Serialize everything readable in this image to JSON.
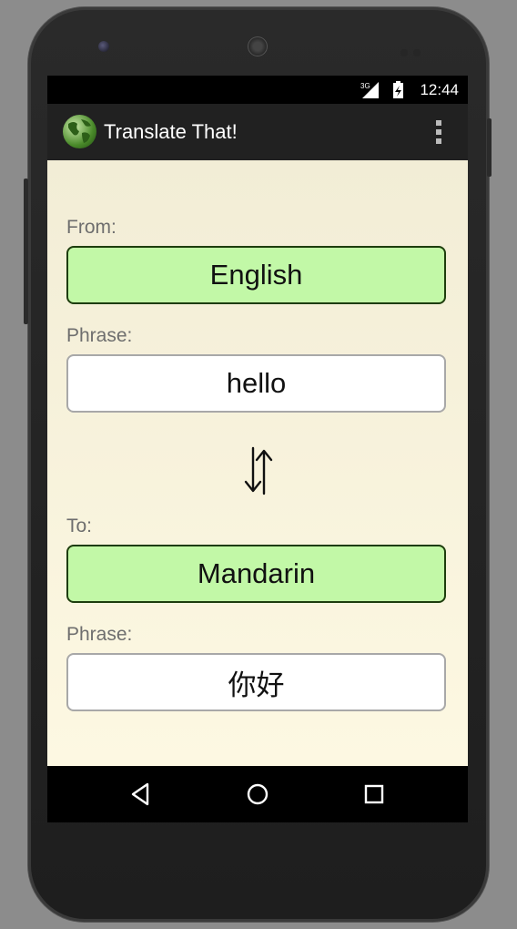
{
  "status_bar": {
    "network": "3G",
    "time": "12:44"
  },
  "action_bar": {
    "title": "Translate That!",
    "logo_icon": "globe-icon",
    "menu_icon": "overflow-menu-icon"
  },
  "form": {
    "from_label": "From:",
    "from_language": "English",
    "from_phrase_label": "Phrase:",
    "from_phrase": "hello",
    "swap_icon": "swap-arrows-icon",
    "to_label": "To:",
    "to_language": "Mandarin",
    "to_phrase_label": "Phrase:",
    "to_phrase": "你好"
  },
  "nav_bar": {
    "back_icon": "back-icon",
    "home_icon": "home-icon",
    "recents_icon": "recents-icon"
  },
  "colors": {
    "language_box": "#c2f8a7",
    "language_border": "#1d3d0d",
    "content_background": "#f6f1dc",
    "action_bar": "#212121"
  }
}
